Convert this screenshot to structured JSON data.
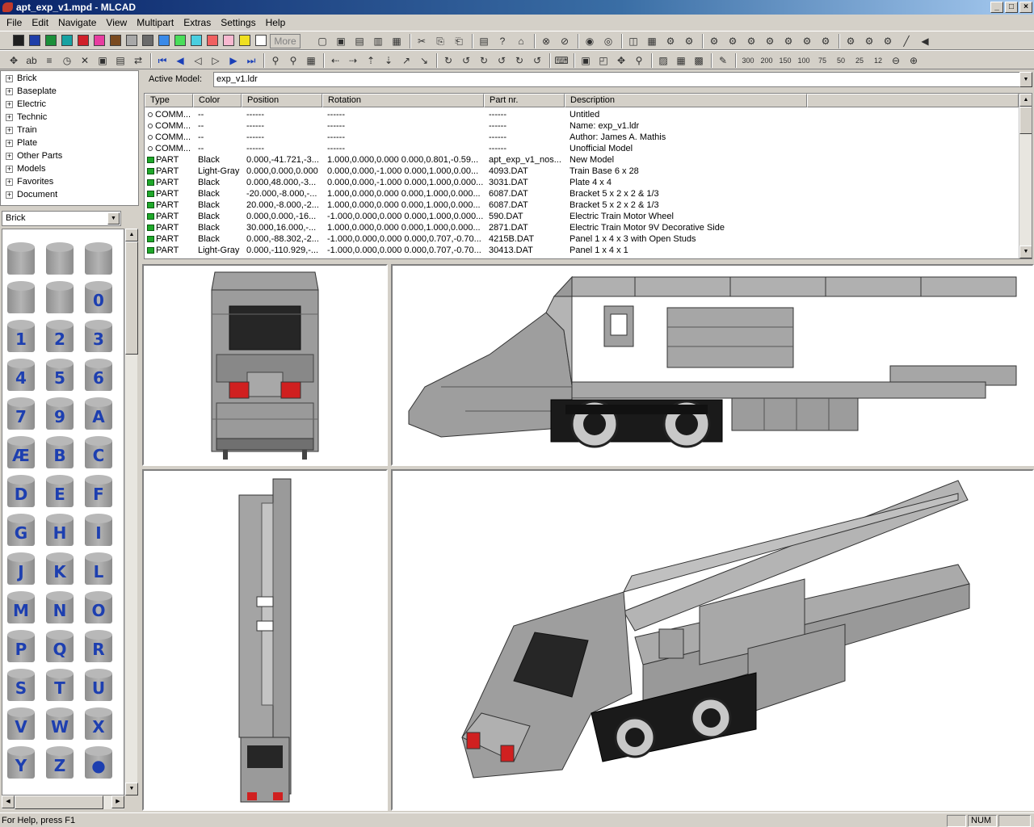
{
  "window": {
    "title": "apt_exp_v1.mpd - MLCAD"
  },
  "menu": [
    "File",
    "Edit",
    "Navigate",
    "View",
    "Multipart",
    "Extras",
    "Settings",
    "Help"
  ],
  "toolbar": {
    "colors": [
      "#202020",
      "#1f3ea8",
      "#1b8f3a",
      "#17a2a2",
      "#d0202a",
      "#e83da0",
      "#7a4a20",
      "#a8a8a8",
      "#6a6a6a",
      "#3a8ae8",
      "#4ade5a",
      "#4acfe0",
      "#f06060",
      "#f8b8d0",
      "#f0e020",
      "#ffffff"
    ],
    "more_label": "More"
  },
  "tree": {
    "items": [
      "Brick",
      "Baseplate",
      "Electric",
      "Technic",
      "Train",
      "Plate",
      "Other Parts",
      "Models",
      "Favorites",
      "Document"
    ]
  },
  "part_filter": {
    "value": "Brick"
  },
  "palette": {
    "labels": [
      "",
      "",
      "",
      "",
      "",
      "0",
      "1",
      "2",
      "3",
      "4",
      "5",
      "6",
      "7",
      "9",
      "A",
      "Æ",
      "B",
      "C",
      "D",
      "E",
      "F",
      "G",
      "H",
      "I",
      "J",
      "K",
      "L",
      "M",
      "N",
      "O",
      "P",
      "Q",
      "R",
      "S",
      "T",
      "U",
      "V",
      "W",
      "X",
      "Y",
      "Z",
      "●"
    ]
  },
  "active_model": {
    "label": "Active Model:",
    "value": "exp_v1.ldr"
  },
  "table": {
    "columns": [
      "Type",
      "Color",
      "Position",
      "Rotation",
      "Part nr.",
      "Description"
    ],
    "rows": [
      {
        "type": "COMM...",
        "color": "--",
        "position": "------",
        "rotation": "------",
        "part": "------",
        "desc": "Untitled",
        "kind": "comm"
      },
      {
        "type": "COMM...",
        "color": "--",
        "position": "------",
        "rotation": "------",
        "part": "------",
        "desc": "Name: exp_v1.ldr",
        "kind": "comm"
      },
      {
        "type": "COMM...",
        "color": "--",
        "position": "------",
        "rotation": "------",
        "part": "------",
        "desc": "Author: James A. Mathis",
        "kind": "comm"
      },
      {
        "type": "COMM...",
        "color": "--",
        "position": "------",
        "rotation": "------",
        "part": "------",
        "desc": "Unofficial Model",
        "kind": "comm"
      },
      {
        "type": "PART",
        "color": "Black",
        "position": "0.000,-41.721,-3...",
        "rotation": "1.000,0.000,0.000 0.000,0.801,-0.59...",
        "part": "apt_exp_v1_nos...",
        "desc": "New Model",
        "kind": "part"
      },
      {
        "type": "PART",
        "color": "Light-Gray",
        "position": "0.000,0.000,0.000",
        "rotation": "0.000,0.000,-1.000 0.000,1.000,0.00...",
        "part": "4093.DAT",
        "desc": "Train Base  6 x 28",
        "kind": "part"
      },
      {
        "type": "PART",
        "color": "Black",
        "position": "0.000,48.000,-3...",
        "rotation": "0.000,0.000,-1.000 0.000,1.000,0.000...",
        "part": "3031.DAT",
        "desc": "Plate  4 x  4",
        "kind": "part"
      },
      {
        "type": "PART",
        "color": "Black",
        "position": "-20.000,-8.000,-...",
        "rotation": "1.000,0.000,0.000 0.000,1.000,0.000...",
        "part": "6087.DAT",
        "desc": "Bracket  5 x  2 x  2 & 1/3",
        "kind": "part"
      },
      {
        "type": "PART",
        "color": "Black",
        "position": "20.000,-8.000,-2...",
        "rotation": "1.000,0.000,0.000 0.000,1.000,0.000...",
        "part": "6087.DAT",
        "desc": "Bracket  5 x  2 x  2 & 1/3",
        "kind": "part"
      },
      {
        "type": "PART",
        "color": "Black",
        "position": "0.000,0.000,-16...",
        "rotation": "-1.000,0.000,0.000 0.000,1.000,0.000...",
        "part": "590.DAT",
        "desc": "Electric Train Motor Wheel",
        "kind": "part"
      },
      {
        "type": "PART",
        "color": "Black",
        "position": "30.000,16.000,-...",
        "rotation": "1.000,0.000,0.000 0.000,1.000,0.000...",
        "part": "2871.DAT",
        "desc": "Electric Train Motor  9V Decorative Side",
        "kind": "part"
      },
      {
        "type": "PART",
        "color": "Black",
        "position": "0.000,-88.302,-2...",
        "rotation": "-1.000,0.000,0.000 0.000,0.707,-0.70...",
        "part": "4215B.DAT",
        "desc": "Panel  1 x  4 x  3 with Open Studs",
        "kind": "part"
      },
      {
        "type": "PART",
        "color": "Light-Gray",
        "position": "0.000,-110.929,-...",
        "rotation": "-1.000,0.000,0.000 0.000,0.707,-0.70...",
        "part": "30413.DAT",
        "desc": "Panel  1 x  4 x  1",
        "kind": "part"
      }
    ]
  },
  "status": {
    "help": "For Help, press F1",
    "num": "NUM"
  }
}
